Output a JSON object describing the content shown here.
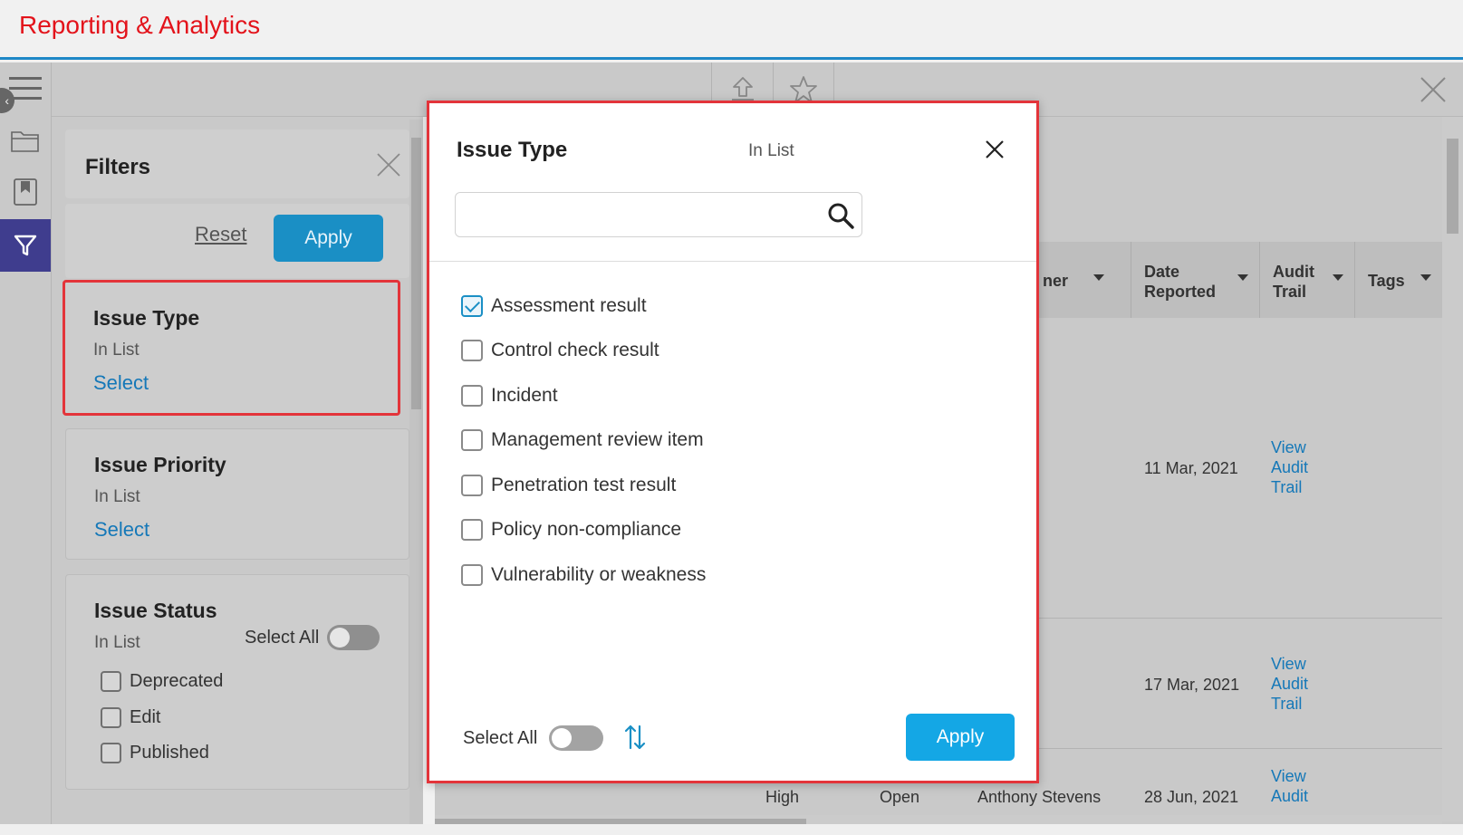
{
  "app": {
    "title": "Reporting & Analytics"
  },
  "filters": {
    "title": "Filters",
    "reset_label": "Reset",
    "apply_label": "Apply",
    "cards": [
      {
        "name": "Issue Type",
        "operator": "In List",
        "action": "Select"
      },
      {
        "name": "Issue Priority",
        "operator": "In List",
        "action": "Select"
      },
      {
        "name": "Issue Status",
        "operator": "In List",
        "select_all_label": "Select All",
        "options": [
          "Deprecated",
          "Edit",
          "Published"
        ]
      }
    ]
  },
  "grid": {
    "columns": [
      {
        "label": "ner"
      },
      {
        "label": "Date Reported"
      },
      {
        "label": "Audit Trail"
      },
      {
        "label": "Tags"
      }
    ],
    "rows": [
      {
        "date": "11 Mar, 2021",
        "audit": "View Audit Trail"
      },
      {
        "date": "17 Mar, 2021",
        "audit": "View Audit Trail"
      },
      {
        "priority": "High",
        "status": "Open",
        "owner": "Anthony Stevens",
        "date": "28 Jun, 2021",
        "audit": "View Audit"
      }
    ]
  },
  "modal": {
    "title": "Issue Type",
    "operator": "In List",
    "search": {
      "value": "",
      "placeholder": ""
    },
    "options": [
      {
        "label": "Assessment result",
        "checked": true
      },
      {
        "label": "Control check result",
        "checked": false
      },
      {
        "label": "Incident",
        "checked": false
      },
      {
        "label": "Management review item",
        "checked": false
      },
      {
        "label": "Penetration test result",
        "checked": false
      },
      {
        "label": "Policy non-compliance",
        "checked": false
      },
      {
        "label": "Vulnerability or weakness",
        "checked": false
      }
    ],
    "select_all_label": "Select All",
    "apply_label": "Apply"
  },
  "colors": {
    "brand": "#e3131b",
    "accent": "#1a8fc5",
    "apply_button": "#14a7e5",
    "link": "#1578b8",
    "highlight": "#e3343a",
    "nav_active": "#3f3d8e"
  }
}
